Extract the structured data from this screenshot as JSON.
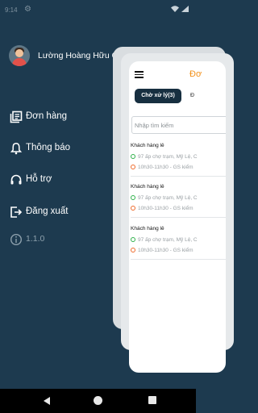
{
  "status_bar": {
    "time": "9:14",
    "icons": [
      "gear-icon",
      "wifi-icon",
      "cell-signal-icon"
    ]
  },
  "drawer": {
    "user_name": "Lường Hoàng Hữu Quang",
    "menu": [
      {
        "label": "Đơn hàng",
        "icon": "orders-icon"
      },
      {
        "label": "Thông báo",
        "icon": "bell-icon"
      },
      {
        "label": "Hỗ trợ",
        "icon": "headset-icon"
      },
      {
        "label": "Đăng xuất",
        "icon": "logout-icon"
      }
    ],
    "version": "1.1.0"
  },
  "screen": {
    "title": "Đơ",
    "tabs": [
      "Chờ xử lý(3)",
      "Đ"
    ],
    "search_placeholder": "Nhập tìm kiếm",
    "orders": [
      {
        "customer": "Khách hàng lẻ",
        "address": "97 ấp chợ trạm, Mỹ Lệ, C",
        "schedule": "10h30-11h30 - GS kiểm"
      },
      {
        "customer": "Khách hàng lẻ",
        "address": "97 ấp chợ trạm, Mỹ Lệ, C",
        "schedule": "10h30-11h30 - GS kiểm"
      },
      {
        "customer": "Khách hàng lẻ",
        "address": "97 ấp chợ trạm, Mỹ Lệ, C",
        "schedule": "10h30-11h30 - GS kiểm"
      }
    ]
  },
  "colors": {
    "drawer_bg": "#1d3a4f",
    "accent_orange": "#f2911b",
    "tab_active_bg": "#172f40",
    "pickup_dot": "#2fb14a",
    "time_dot": "#ee6a2b"
  }
}
